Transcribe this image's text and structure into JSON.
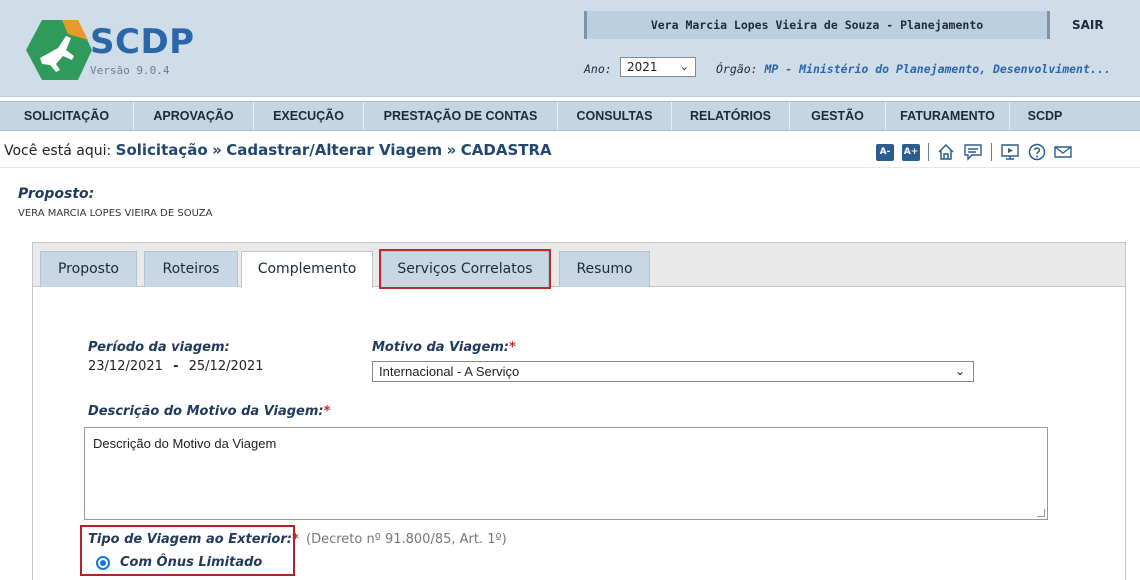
{
  "header": {
    "brand": "SCDP",
    "version": "Versão 9.0.4",
    "user": "Vera Marcia Lopes Vieira de Souza - Planejamento",
    "logout": "SAIR",
    "ano_label": "Ano:",
    "ano_value": "2021",
    "orgao_label": "Órgão:",
    "orgao_value": "MP - Ministério do Planejamento, Desenvolviment..."
  },
  "menu": {
    "items": [
      {
        "label": "SOLICITAÇÃO"
      },
      {
        "label": "APROVAÇÃO"
      },
      {
        "label": "EXECUÇÃO"
      },
      {
        "label": "PRESTAÇÃO DE CONTAS"
      },
      {
        "label": "CONSULTAS"
      },
      {
        "label": "RELATÓRIOS"
      },
      {
        "label": "GESTÃO"
      },
      {
        "label": "FATURAMENTO"
      },
      {
        "label": "SCDP"
      }
    ]
  },
  "breadcrumb": {
    "prefix": "Você está aqui:",
    "items": [
      "Solicitação",
      "Cadastrar/Alterar Viagem",
      "CADASTRA"
    ],
    "font_decrease": "A-",
    "font_increase": "A+"
  },
  "proposto": {
    "title": "Proposto:",
    "name": "VERA MARCIA LOPES VIEIRA DE SOUZA"
  },
  "tabs": [
    {
      "label": "Proposto"
    },
    {
      "label": "Roteiros"
    },
    {
      "label": "Complemento"
    },
    {
      "label": "Serviços Correlatos"
    },
    {
      "label": "Resumo"
    }
  ],
  "form": {
    "periodo_label": "Período da viagem:",
    "periodo_start": "23/12/2021",
    "periodo_sep": "-",
    "periodo_end": "25/12/2021",
    "motivo_label": "Motivo da Viagem:",
    "motivo_value": "Internacional - A Serviço",
    "descricao_label": "Descrição do Motivo da Viagem:",
    "descricao_value": "Descrição do Motivo da Viagem",
    "tipo_label": "Tipo de Viagem ao Exterior:",
    "decreto": "(Decreto nº 91.800/85, Art. 1º)",
    "tipo_option": "Com Ônus Limitado",
    "required_mark": "*"
  },
  "colors": {
    "brand_blue": "#2a66a8",
    "header_bg": "#cfdde9",
    "highlight_red": "#c0282c",
    "logo_green": "#2f9a5a",
    "logo_orange": "#e59a2b"
  }
}
